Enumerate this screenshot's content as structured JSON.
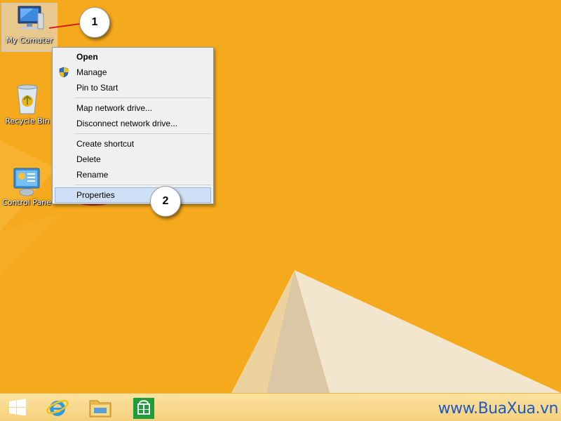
{
  "desktop": {
    "background_color": "#f5a91c",
    "icons": [
      {
        "label": "My Comuter",
        "icon": "computer-icon",
        "selected": true
      },
      {
        "label": "Recycle Bin",
        "icon": "recycle-bin-icon",
        "selected": false
      },
      {
        "label": "Control Pane",
        "icon": "control-panel-icon",
        "selected": false
      }
    ]
  },
  "context_menu": {
    "items": [
      {
        "label": "Open",
        "bold": true
      },
      {
        "label": "Manage",
        "icon": "uac-shield-icon"
      },
      {
        "label": "Pin to Start"
      },
      {
        "label": "Map network drive..."
      },
      {
        "label": "Disconnect network drive..."
      },
      {
        "label": "Create shortcut"
      },
      {
        "label": "Delete"
      },
      {
        "label": "Rename"
      },
      {
        "label": "Properties",
        "highlighted": true
      }
    ]
  },
  "callouts": [
    {
      "number": "1",
      "points_to": "My Comuter"
    },
    {
      "number": "2",
      "points_to": "Properties"
    }
  ],
  "taskbar": {
    "buttons": [
      {
        "name": "start-button",
        "icon": "windows-logo-icon"
      },
      {
        "name": "internet-explorer",
        "icon": "ie-icon"
      },
      {
        "name": "file-explorer",
        "icon": "folder-icon"
      },
      {
        "name": "store",
        "icon": "store-icon"
      }
    ],
    "watermark": "www.BuaXua.vn"
  }
}
